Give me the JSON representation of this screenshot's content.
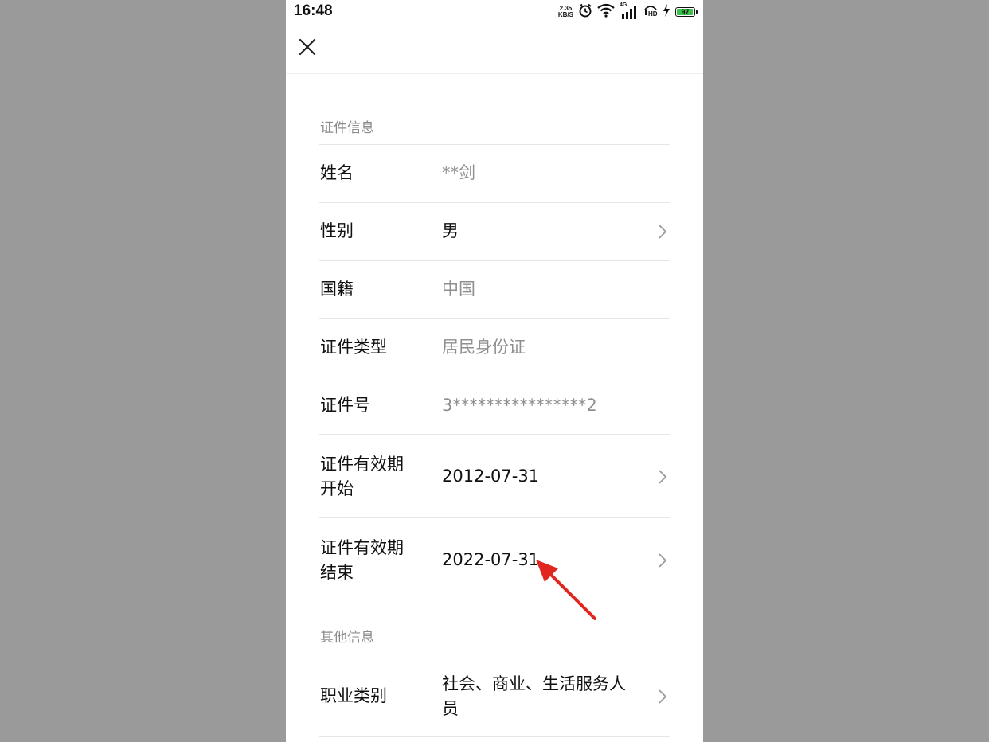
{
  "status_bar": {
    "time": "16:48",
    "net_speed_value": "2.35",
    "net_speed_unit": "KB/S",
    "signal_label": "4G",
    "battery": "97",
    "battery_level": 0.97,
    "icons": [
      "alarm-icon",
      "wifi-icon",
      "signal-icon",
      "hd-icon",
      "charging-icon",
      "battery-icon"
    ]
  },
  "nav": {
    "close_icon": "close-icon"
  },
  "sections": [
    {
      "title": "证件信息",
      "rows": [
        {
          "label": "姓名",
          "value": "**剑",
          "editable": false
        },
        {
          "label": "性别",
          "value": "男",
          "editable": true
        },
        {
          "label": "国籍",
          "value": "中国",
          "editable": false
        },
        {
          "label": "证件类型",
          "value": "居民身份证",
          "editable": false
        },
        {
          "label": "证件号",
          "value": "3****************2",
          "editable": false
        },
        {
          "label": "证件有效期\n开始",
          "value": "2012-07-31",
          "editable": true
        },
        {
          "label": "证件有效期\n结束",
          "value": "2022-07-31",
          "editable": true
        }
      ]
    },
    {
      "title": "其他信息",
      "rows": [
        {
          "label": "职业类别",
          "value": "社会、商业、生活服务人员",
          "editable": true
        }
      ]
    }
  ],
  "colors": {
    "background": "#9a9a9a",
    "panel": "#ffffff",
    "muted_text": "#8f8f8f",
    "annotation_arrow": "#e0261f",
    "battery_fill": "#3cc24a"
  }
}
